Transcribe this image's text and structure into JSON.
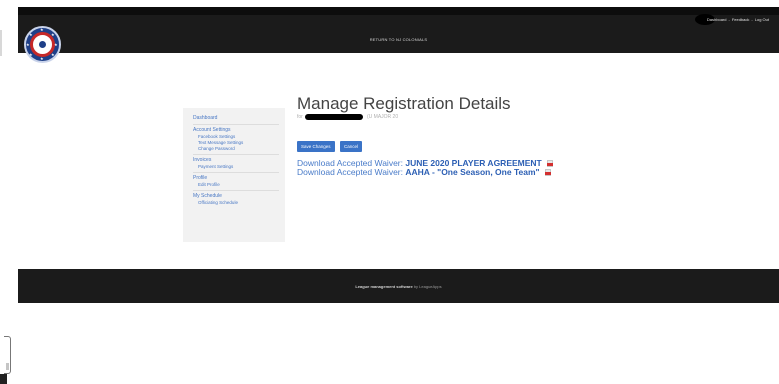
{
  "header": {
    "top_links": [
      "Dashboard",
      "Feedback",
      "Log Out"
    ],
    "link_separator": "-",
    "return_link": "RETURN TO NJ COLONIALS"
  },
  "sidebar": {
    "groups": [
      {
        "title": "Dashboard",
        "items": []
      },
      {
        "title": "Account Settings",
        "items": [
          "Facebook Settings",
          "Text Message Settings",
          "Change Password"
        ]
      },
      {
        "title": "Invoices",
        "items": [
          "Payment Settings"
        ]
      },
      {
        "title": "Profile",
        "items": [
          "Edit Profile"
        ]
      },
      {
        "title": "My Schedule",
        "items": [
          "Officiating Schedule"
        ]
      }
    ]
  },
  "main": {
    "title": "Manage Registration Details",
    "subtitle_prefix": "for",
    "subtitle_suffix": "(U MAJOR 20",
    "buttons": {
      "save": "Save Changes",
      "cancel": "Cancel"
    },
    "waiver_label": "Download Accepted Waiver:",
    "waivers": [
      {
        "name": "JUNE 2020 PLAYER AGREEMENT"
      },
      {
        "name": "AAHA - \"One Season, One Team\""
      }
    ]
  },
  "footer": {
    "bold_text": "League management software",
    "rest_text": "by LeagueApps"
  },
  "colors": {
    "bar": "#1b1b1b",
    "link": "#4877c4",
    "button": "#3a73c7",
    "pdf_red": "#d32f2f",
    "logo_blue": "#1e3f88",
    "logo_red": "#c62828"
  }
}
